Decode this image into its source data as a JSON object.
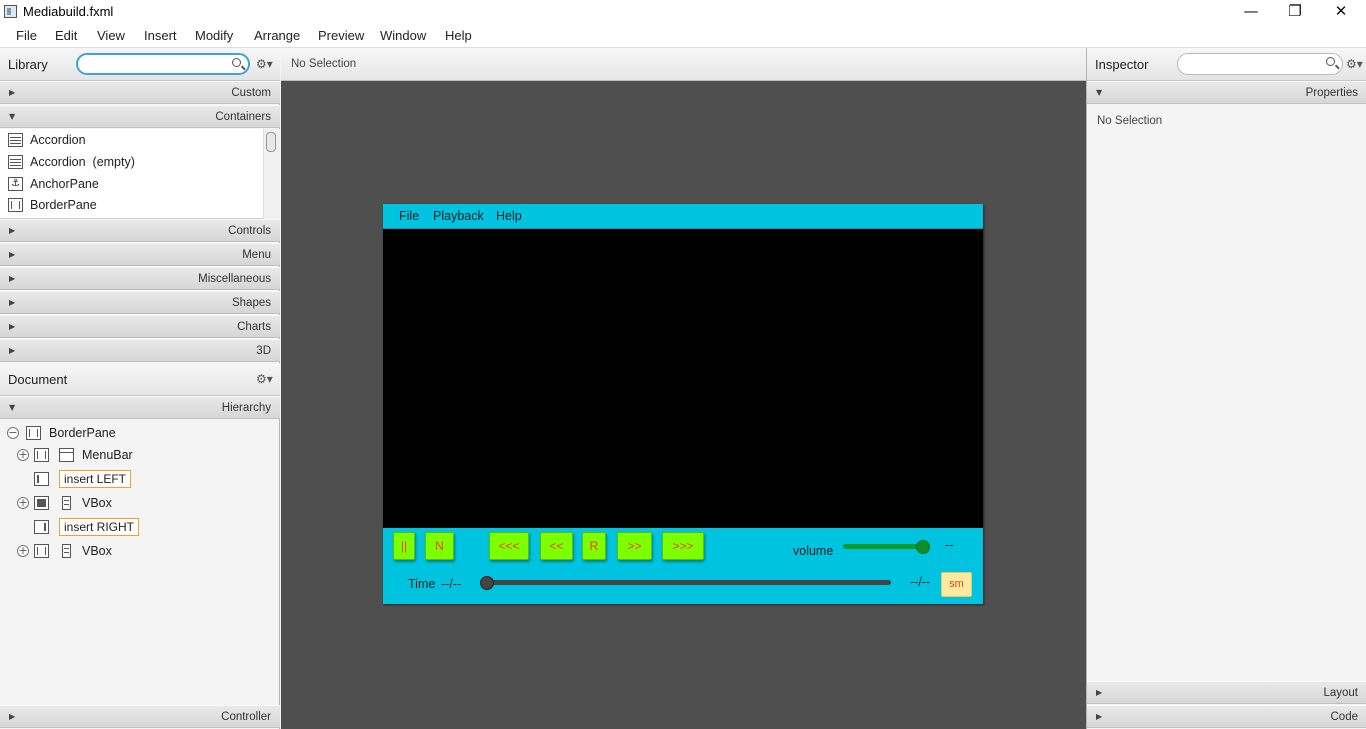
{
  "window": {
    "title": "Mediabuild.fxml",
    "minimize_glyph": "—",
    "restore_glyph": "❐",
    "close_glyph": "✕"
  },
  "menubar": [
    "File",
    "Edit",
    "View",
    "Insert",
    "Modify",
    "Arrange",
    "Preview",
    "Window",
    "Help"
  ],
  "library": {
    "title": "Library",
    "search_value": "",
    "sections": [
      "Custom",
      "Containers",
      "Controls",
      "Menu",
      "Miscellaneous",
      "Shapes",
      "Charts",
      "3D"
    ],
    "container_items": [
      "Accordion",
      "Accordion  (empty)",
      "AnchorPane",
      "BorderPane"
    ]
  },
  "document": {
    "title": "Document",
    "hierarchy_label": "Hierarchy",
    "nodes": [
      "BorderPane",
      "MenuBar",
      "insert LEFT",
      "VBox",
      "insert RIGHT",
      "VBox"
    ],
    "controller_label": "Controller"
  },
  "canvas": {
    "selection_status": "No Selection",
    "app_menu": [
      "File",
      "Playback",
      "Help"
    ],
    "buttons": [
      "||",
      "N",
      "<<<",
      "<<",
      "R",
      ">>",
      ">>>"
    ],
    "volume_label": "volume",
    "volume_value_text": "--",
    "volume_level": 0.95,
    "time_label": "Time",
    "time_current": "--/--",
    "time_total": "--/--",
    "time_progress": 0.0,
    "sm_label": "sm",
    "colors": {
      "toolbar_bg": "#00c3df",
      "button_bg": "#7cff00",
      "button_text": "#ff3a1a",
      "sm_bg": "#ffe9a0"
    }
  },
  "inspector": {
    "title": "Inspector",
    "search_value": "",
    "properties_label": "Properties",
    "status": "No Selection",
    "layout_label": "Layout",
    "code_label": "Code"
  }
}
